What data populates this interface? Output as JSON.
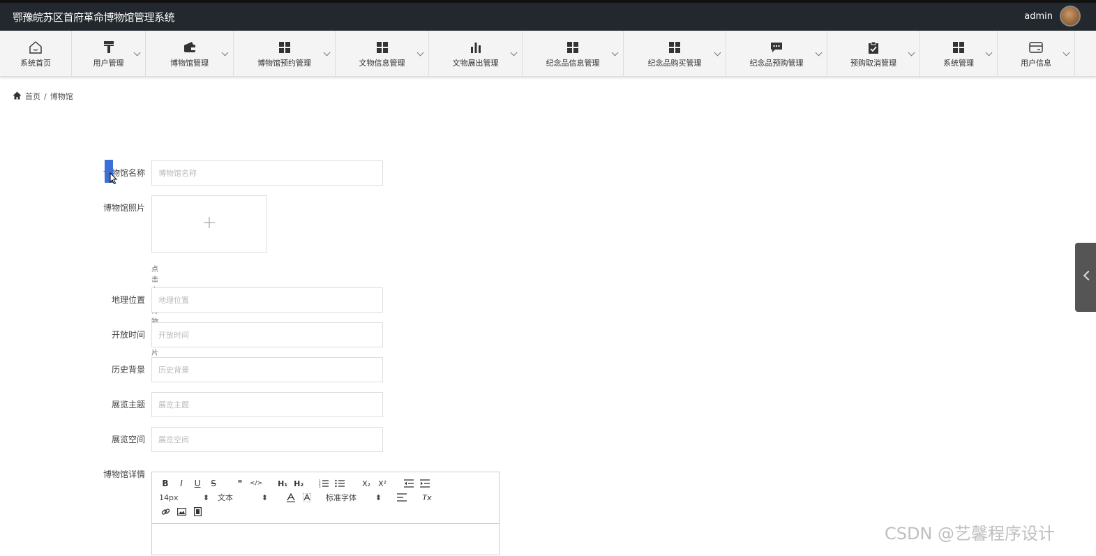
{
  "app": {
    "title": "鄂豫皖苏区首府革命博物馆管理系统"
  },
  "user": {
    "name": "admin"
  },
  "nav": [
    {
      "label": "系统首页",
      "icon": "home-icon"
    },
    {
      "label": "用户管理",
      "icon": "brush-icon"
    },
    {
      "label": "博物馆管理",
      "icon": "wallet-icon"
    },
    {
      "label": "博物馆预约管理",
      "icon": "grid-icon"
    },
    {
      "label": "文物信息管理",
      "icon": "grid-icon"
    },
    {
      "label": "文物展出管理",
      "icon": "bar-chart-icon"
    },
    {
      "label": "纪念品信息管理",
      "icon": "grid-icon"
    },
    {
      "label": "纪念品购买管理",
      "icon": "grid-icon"
    },
    {
      "label": "纪念品预购管理",
      "icon": "chat-icon"
    },
    {
      "label": "预购取消管理",
      "icon": "clipboard-check-icon"
    },
    {
      "label": "系统管理",
      "icon": "grid-icon"
    },
    {
      "label": "用户信息",
      "icon": "card-icon"
    }
  ],
  "breadcrumb": {
    "home": "首页",
    "separator": "/",
    "current": "博物馆"
  },
  "form": {
    "name": {
      "label": "博物馆名称",
      "placeholder": "博物馆名称"
    },
    "photo": {
      "label": "博物馆照片",
      "hint": "点击上传博物馆照片"
    },
    "location": {
      "label": "地理位置",
      "placeholder": "地理位置"
    },
    "hours": {
      "label": "开放时间",
      "placeholder": "开放时间"
    },
    "history": {
      "label": "历史背景",
      "placeholder": "历史背景"
    },
    "theme": {
      "label": "展览主题",
      "placeholder": "展览主题"
    },
    "space": {
      "label": "展览空间",
      "placeholder": "展览空间"
    },
    "details": {
      "label": "博物馆详情"
    }
  },
  "editor": {
    "font_size": "14px",
    "text_type": "文本",
    "font_family": "标准字体",
    "buttons": {
      "bold": "B",
      "italic": "I",
      "underline": "U",
      "strike": "S",
      "quote": "❞",
      "code": "</>",
      "h1": "H₁",
      "h2": "H₂",
      "sub": "X₂",
      "sup": "X²",
      "clear": "Tx"
    }
  },
  "watermark": "CSDN @艺馨程序设计"
}
